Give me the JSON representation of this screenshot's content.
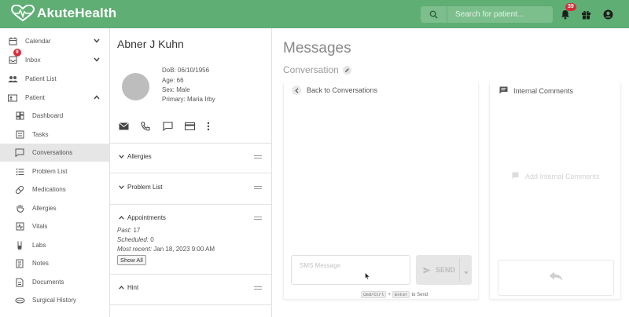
{
  "app": {
    "logo_text": "AkuteHealth",
    "search_placeholder": "Search for patient...",
    "notification_count": "39"
  },
  "sidebar": {
    "inbox_badge": "9",
    "items": [
      {
        "label": "Calendar",
        "icon": "calendar-icon",
        "chevron": "down"
      },
      {
        "label": "Inbox",
        "icon": "inbox-icon",
        "chevron": "down"
      },
      {
        "label": "Patient List",
        "icon": "people-icon"
      },
      {
        "label": "Patient",
        "icon": "patient-card-icon",
        "chevron": "up"
      },
      {
        "label": "Dashboard",
        "icon": "dashboard-icon"
      },
      {
        "label": "Tasks",
        "icon": "tasks-icon"
      },
      {
        "label": "Conversations",
        "icon": "chat-icon",
        "active": true
      },
      {
        "label": "Problem List",
        "icon": "list-icon"
      },
      {
        "label": "Medications",
        "icon": "pill-icon"
      },
      {
        "label": "Allergies",
        "icon": "hand-icon"
      },
      {
        "label": "Vitals",
        "icon": "vitals-icon"
      },
      {
        "label": "Labs",
        "icon": "test-tube-icon"
      },
      {
        "label": "Notes",
        "icon": "notes-icon"
      },
      {
        "label": "Documents",
        "icon": "document-icon"
      },
      {
        "label": "Surgical History",
        "icon": "surgical-icon"
      }
    ]
  },
  "patient": {
    "name": "Abner J Kuhn",
    "dob": "DoB: 06/10/1956",
    "age": "Age: 66",
    "sex": "Sex: Male",
    "primary": "Primary: Maria Irby",
    "sections": {
      "allergies": "Allergies",
      "problem_list": "Problem List",
      "appointments": "Appointments",
      "hint": "Hint"
    },
    "appointments": {
      "past_label": "Past:",
      "past_value": "17",
      "scheduled_label": "Scheduled:",
      "scheduled_value": "0",
      "recent_label": "Most recent:",
      "recent_value": "Jan 18, 2023 9:00 AM",
      "show_all": "Show All"
    }
  },
  "main": {
    "title": "Messages",
    "subtitle": "Conversation",
    "back_label": "Back to Conversations",
    "sms_placeholder": "SMS Message",
    "send_label": "SEND",
    "kbd_mod": "Cmd/Ctrl",
    "kbd_plus": "+",
    "kbd_enter": "Enter",
    "kbd_suffix": "to Send",
    "comments_title": "Internal Comments",
    "add_comments": "Add Internal Comments"
  },
  "colors": {
    "topbar": "#5fae74",
    "badge": "#d62c3a",
    "active_nav": "#e6e6e6"
  }
}
